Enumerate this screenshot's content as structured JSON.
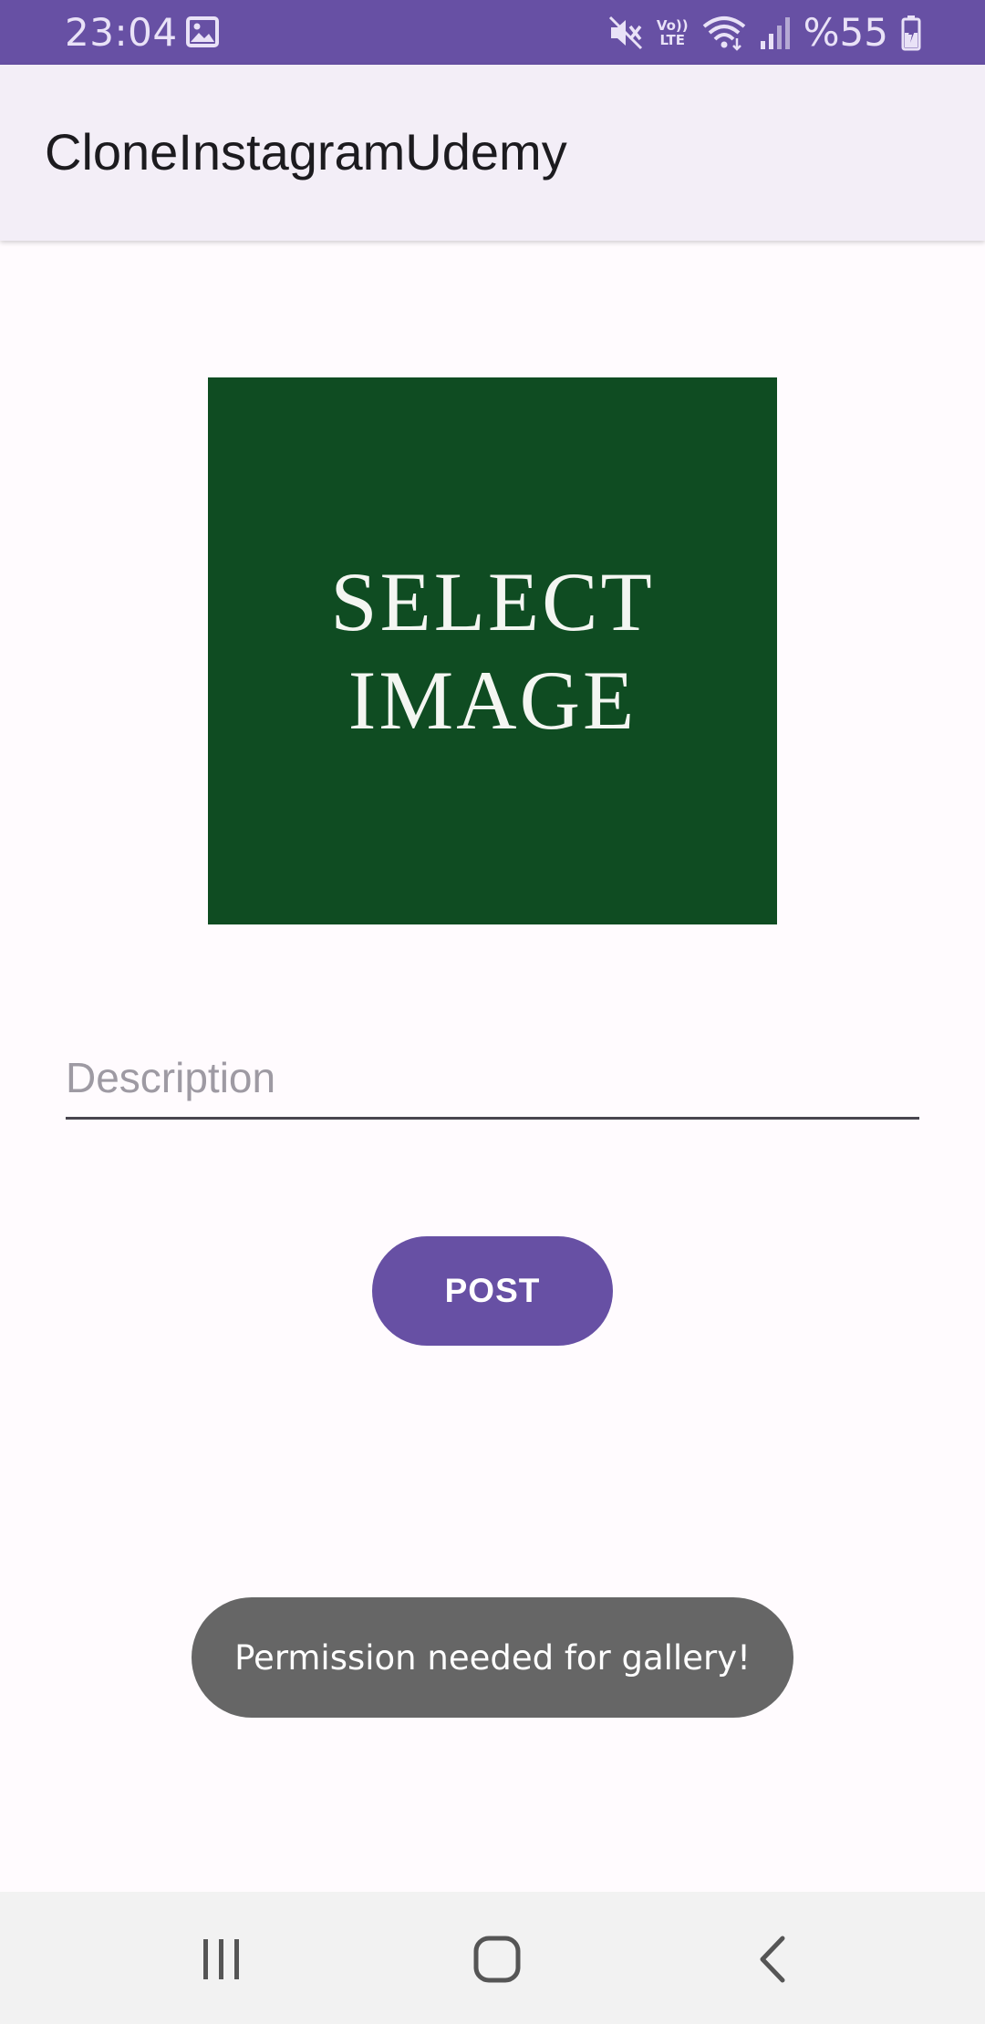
{
  "status_bar": {
    "time": "23:04",
    "battery": "%55",
    "volte_top": "Vo))",
    "volte_bottom": "LTE",
    "icons": [
      "gallery-icon",
      "mute-icon",
      "volte-icon",
      "wifi-icon",
      "signal-icon",
      "battery-icon"
    ]
  },
  "app_bar": {
    "title": "CloneInstagramUdemy"
  },
  "main": {
    "select_image": {
      "line1": "SELECT",
      "line2": "IMAGE"
    },
    "description": {
      "placeholder": "Description",
      "value": ""
    },
    "post_button": "POST"
  },
  "toast": {
    "message": "Permission needed for gallery!"
  },
  "nav_bar": {
    "items": [
      "recents-icon",
      "home-icon",
      "back-icon"
    ]
  },
  "colors": {
    "primary": "#6750a4",
    "app_bar_bg": "#f3eef7",
    "image_bg": "#0f4c22",
    "toast_bg": "#666666",
    "page_bg": "#fffbfe"
  }
}
